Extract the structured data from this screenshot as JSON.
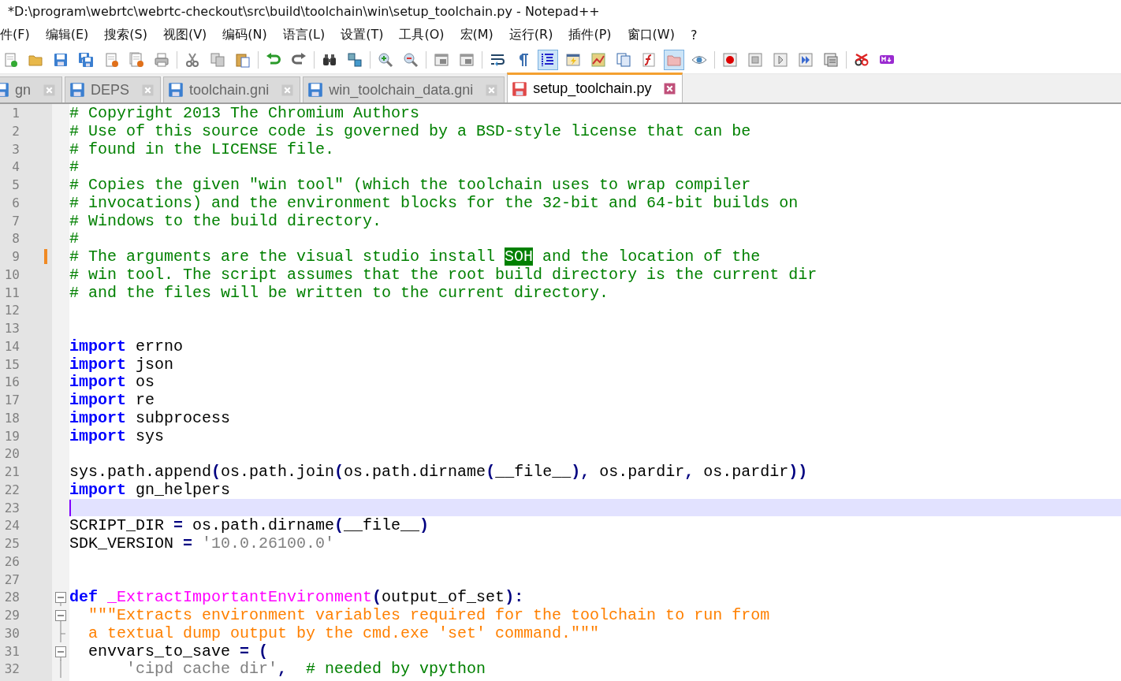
{
  "window": {
    "title": "*D:\\program\\webrtc\\webrtc-checkout\\src\\build\\toolchain\\win\\setup_toolchain.py - Notepad++"
  },
  "menu": [
    "件(F)",
    "编辑(E)",
    "搜索(S)",
    "视图(V)",
    "编码(N)",
    "语言(L)",
    "设置(T)",
    "工具(O)",
    "宏(M)",
    "运行(R)",
    "插件(P)",
    "窗口(W)",
    "?"
  ],
  "toolbar": [
    [
      {
        "kind": "new",
        "selected": false
      },
      {
        "kind": "open",
        "selected": false
      },
      {
        "kind": "save",
        "selected": false
      },
      {
        "kind": "save-all",
        "selected": false
      },
      {
        "kind": "close",
        "selected": false
      },
      {
        "kind": "close-all",
        "selected": false
      },
      {
        "kind": "print",
        "selected": false
      }
    ],
    [
      {
        "kind": "cut",
        "selected": false
      },
      {
        "kind": "copy",
        "selected": false
      },
      {
        "kind": "paste",
        "selected": false
      }
    ],
    [
      {
        "kind": "undo",
        "selected": false
      },
      {
        "kind": "redo",
        "selected": false
      }
    ],
    [
      {
        "kind": "find",
        "selected": false
      },
      {
        "kind": "replace",
        "selected": false
      }
    ],
    [
      {
        "kind": "zoom-in",
        "selected": false
      },
      {
        "kind": "zoom-out",
        "selected": false
      }
    ],
    [
      {
        "kind": "sync-v",
        "selected": false
      },
      {
        "kind": "sync-h",
        "selected": false
      }
    ],
    [
      {
        "kind": "wrap",
        "selected": false
      },
      {
        "kind": "all-chars",
        "selected": false
      },
      {
        "kind": "indent-guide",
        "selected": true
      },
      {
        "kind": "udl",
        "selected": false
      },
      {
        "kind": "doc-map",
        "selected": false
      },
      {
        "kind": "doc-list",
        "selected": false
      },
      {
        "kind": "function-list",
        "selected": false
      },
      {
        "kind": "folder-workspace",
        "selected": true
      },
      {
        "kind": "monitor",
        "selected": false
      }
    ],
    [
      {
        "kind": "record",
        "selected": false
      },
      {
        "kind": "stop",
        "selected": false
      },
      {
        "kind": "play",
        "selected": false
      },
      {
        "kind": "play-multi",
        "selected": false
      },
      {
        "kind": "save-macro",
        "selected": false
      }
    ],
    [
      {
        "kind": "spell",
        "selected": false
      },
      {
        "kind": "markdown",
        "selected": false
      }
    ]
  ],
  "tabs": [
    {
      "label": "gn",
      "selected": false,
      "modified": false
    },
    {
      "label": "DEPS",
      "selected": false,
      "modified": false
    },
    {
      "label": "toolchain.gni",
      "selected": false,
      "modified": false
    },
    {
      "label": "win_toolchain_data.gni",
      "selected": false,
      "modified": false
    },
    {
      "label": "setup_toolchain.py",
      "selected": true,
      "modified": true
    }
  ],
  "lines": [
    {
      "number": "1",
      "kind": "text",
      "changed": false,
      "current": false,
      "tokens": [
        {
          "kind": "comment",
          "text": "# Copyright 2013 The Chromium Authors"
        }
      ]
    },
    {
      "number": "2",
      "kind": "text",
      "changed": false,
      "current": false,
      "tokens": [
        {
          "kind": "comment",
          "text": "# Use of this source code is governed by a BSD-style license that can be"
        }
      ]
    },
    {
      "number": "3",
      "kind": "text",
      "changed": false,
      "current": false,
      "tokens": [
        {
          "kind": "comment",
          "text": "# found in the LICENSE file."
        }
      ]
    },
    {
      "number": "4",
      "kind": "text",
      "changed": false,
      "current": false,
      "tokens": [
        {
          "kind": "comment",
          "text": "#"
        }
      ]
    },
    {
      "number": "5",
      "kind": "text",
      "changed": false,
      "current": false,
      "tokens": [
        {
          "kind": "comment",
          "text": "# Copies the given \"win tool\" (which the toolchain uses to wrap compiler"
        }
      ]
    },
    {
      "number": "6",
      "kind": "text",
      "changed": false,
      "current": false,
      "tokens": [
        {
          "kind": "comment",
          "text": "# invocations) and the environment blocks for the 32-bit and 64-bit builds on"
        }
      ]
    },
    {
      "number": "7",
      "kind": "text",
      "changed": false,
      "current": false,
      "tokens": [
        {
          "kind": "comment",
          "text": "# Windows to the build directory."
        }
      ]
    },
    {
      "number": "8",
      "kind": "text",
      "changed": false,
      "current": false,
      "tokens": [
        {
          "kind": "comment",
          "text": "#"
        }
      ]
    },
    {
      "number": "9",
      "kind": "text",
      "changed": true,
      "current": false,
      "tokens": [
        {
          "kind": "comment",
          "text": "# The arguments are the visual studio install "
        },
        {
          "kind": "control",
          "text": "SOH"
        },
        {
          "kind": "comment",
          "text": " and the location of the"
        }
      ]
    },
    {
      "number": "10",
      "kind": "text",
      "changed": false,
      "current": false,
      "tokens": [
        {
          "kind": "comment",
          "text": "# win tool. The script assumes that the root build directory is the current dir"
        }
      ]
    },
    {
      "number": "11",
      "kind": "text",
      "changed": false,
      "current": false,
      "tokens": [
        {
          "kind": "comment",
          "text": "# and the files will be written to the current directory."
        }
      ]
    },
    {
      "number": "12",
      "kind": "text",
      "changed": false,
      "current": false
    },
    {
      "number": "13",
      "kind": "text",
      "changed": false,
      "current": false
    },
    {
      "number": "14",
      "kind": "text",
      "changed": false,
      "current": false,
      "tokens": [
        {
          "kind": "keyword",
          "text": "import"
        },
        {
          "kind": "plain",
          "text": " errno"
        }
      ]
    },
    {
      "number": "15",
      "kind": "text",
      "changed": false,
      "current": false,
      "tokens": [
        {
          "kind": "keyword",
          "text": "import"
        },
        {
          "kind": "plain",
          "text": " json"
        }
      ]
    },
    {
      "number": "16",
      "kind": "text",
      "changed": false,
      "current": false,
      "tokens": [
        {
          "kind": "keyword",
          "text": "import"
        },
        {
          "kind": "plain",
          "text": " os"
        }
      ]
    },
    {
      "number": "17",
      "kind": "text",
      "changed": false,
      "current": false,
      "tokens": [
        {
          "kind": "keyword",
          "text": "import"
        },
        {
          "kind": "plain",
          "text": " re"
        }
      ]
    },
    {
      "number": "18",
      "kind": "text",
      "changed": false,
      "current": false,
      "tokens": [
        {
          "kind": "keyword",
          "text": "import"
        },
        {
          "kind": "plain",
          "text": " subprocess"
        }
      ]
    },
    {
      "number": "19",
      "kind": "text",
      "changed": false,
      "current": false,
      "tokens": [
        {
          "kind": "keyword",
          "text": "import"
        },
        {
          "kind": "plain",
          "text": " sys"
        }
      ]
    },
    {
      "number": "20",
      "kind": "text",
      "changed": false,
      "current": false
    },
    {
      "number": "21",
      "kind": "text",
      "changed": false,
      "current": false,
      "tokens": [
        {
          "kind": "plain",
          "text": "sys.path.append"
        },
        {
          "kind": "op",
          "text": "("
        },
        {
          "kind": "plain",
          "text": "os.path.join"
        },
        {
          "kind": "op",
          "text": "("
        },
        {
          "kind": "plain",
          "text": "os.path.dirname"
        },
        {
          "kind": "op",
          "text": "("
        },
        {
          "kind": "plain",
          "text": "__file__"
        },
        {
          "kind": "op",
          "text": "),"
        },
        {
          "kind": "plain",
          "text": " os.pardir"
        },
        {
          "kind": "op",
          "text": ","
        },
        {
          "kind": "plain",
          "text": " os.pardir"
        },
        {
          "kind": "op",
          "text": "))"
        }
      ]
    },
    {
      "number": "22",
      "kind": "text",
      "changed": false,
      "current": false,
      "tokens": [
        {
          "kind": "keyword",
          "text": "import"
        },
        {
          "kind": "plain",
          "text": " gn_helpers"
        }
      ]
    },
    {
      "number": "23",
      "kind": "text",
      "changed": false,
      "current": true
    },
    {
      "number": "24",
      "kind": "text",
      "changed": false,
      "current": false,
      "tokens": [
        {
          "kind": "plain",
          "text": "SCRIPT_DIR "
        },
        {
          "kind": "op",
          "text": "="
        },
        {
          "kind": "plain",
          "text": " os.path.dirname"
        },
        {
          "kind": "op",
          "text": "("
        },
        {
          "kind": "plain",
          "text": "__file__"
        },
        {
          "kind": "op",
          "text": ")"
        }
      ]
    },
    {
      "number": "25",
      "kind": "text",
      "changed": false,
      "current": false,
      "tokens": [
        {
          "kind": "plain",
          "text": "SDK_VERSION "
        },
        {
          "kind": "op",
          "text": "="
        },
        {
          "kind": "string",
          "text": " '10.0.26100.0'"
        }
      ]
    },
    {
      "number": "26",
      "kind": "text",
      "changed": false,
      "current": false
    },
    {
      "number": "27",
      "kind": "text",
      "changed": false,
      "current": false
    },
    {
      "number": "28",
      "kind": "fold_start",
      "changed": false,
      "current": false,
      "tokens": [
        {
          "kind": "keyword",
          "text": "def"
        },
        {
          "kind": "func",
          "text": " _ExtractImportantEnvironment"
        },
        {
          "kind": "op",
          "text": "("
        },
        {
          "kind": "plain",
          "text": "output_of_set"
        },
        {
          "kind": "op",
          "text": "):"
        }
      ]
    },
    {
      "number": "29",
      "kind": "fold_start",
      "changed": false,
      "current": false,
      "tokens": [
        {
          "kind": "doc",
          "text": "  \"\"\"Extracts environment variables required for the toolchain to run from"
        }
      ]
    },
    {
      "number": "30",
      "kind": "fold_end",
      "changed": false,
      "current": false,
      "tokens": [
        {
          "kind": "doc",
          "text": "  a textual dump output by the cmd.exe 'set' command.\"\"\""
        }
      ]
    },
    {
      "number": "31",
      "kind": "fold_start",
      "changed": false,
      "current": false,
      "tokens": [
        {
          "kind": "plain",
          "text": "  envvars_to_save "
        },
        {
          "kind": "op",
          "text": "= ("
        }
      ]
    },
    {
      "number": "32",
      "kind": "fold_body",
      "changed": false,
      "current": false,
      "tokens": [
        {
          "kind": "string",
          "text": "      'cipd cache dir'"
        },
        {
          "kind": "op",
          "text": ","
        },
        {
          "kind": "comment",
          "text": "  # needed by vpython"
        }
      ]
    }
  ]
}
